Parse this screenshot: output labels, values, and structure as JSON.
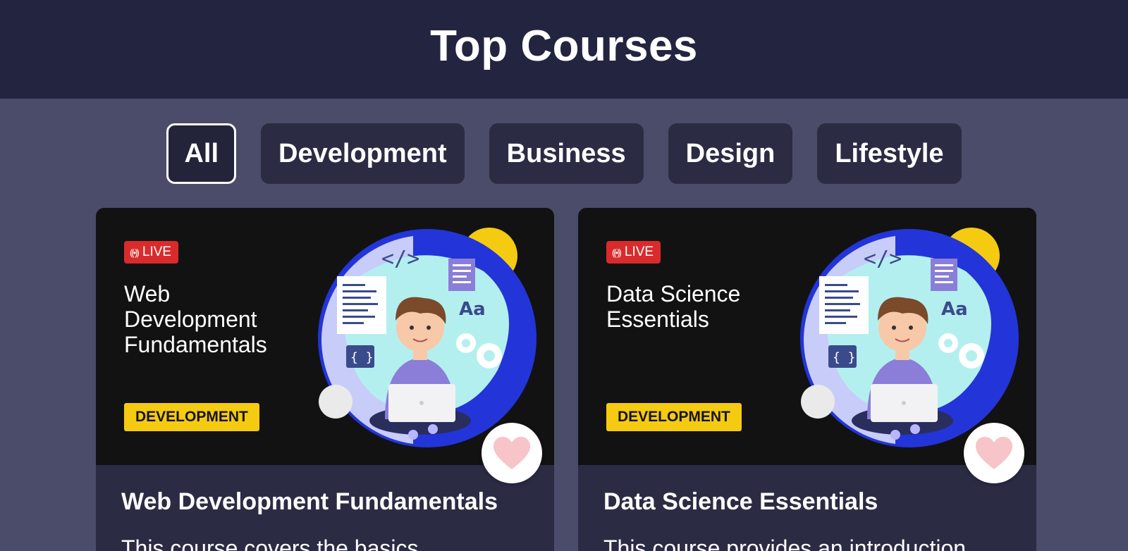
{
  "header": {
    "title": "Top Courses"
  },
  "filters": [
    {
      "label": "All",
      "active": true
    },
    {
      "label": "Development",
      "active": false
    },
    {
      "label": "Business",
      "active": false
    },
    {
      "label": "Design",
      "active": false
    },
    {
      "label": "Lifestyle",
      "active": false
    }
  ],
  "courses": [
    {
      "badge": "LIVE",
      "thumb_title": "Web Development Fundamentals",
      "category": "DEVELOPMENT",
      "title": "Web Development Fundamentals",
      "description": "This course covers the basics"
    },
    {
      "badge": "LIVE",
      "thumb_title": "Data Science Essentials",
      "category": "DEVELOPMENT",
      "title": "Data Science Essentials",
      "description": "This course provides an introduction"
    }
  ],
  "colors": {
    "header_bg": "#232440",
    "page_bg": "#4a4c69",
    "chip_bg": "#2b2c44",
    "live_red": "#d92b2b",
    "tag_yellow": "#f5cb11",
    "heart_pink": "#f7c4c9"
  },
  "icons": {
    "live": "broadcast-icon",
    "favorite": "heart-icon"
  }
}
